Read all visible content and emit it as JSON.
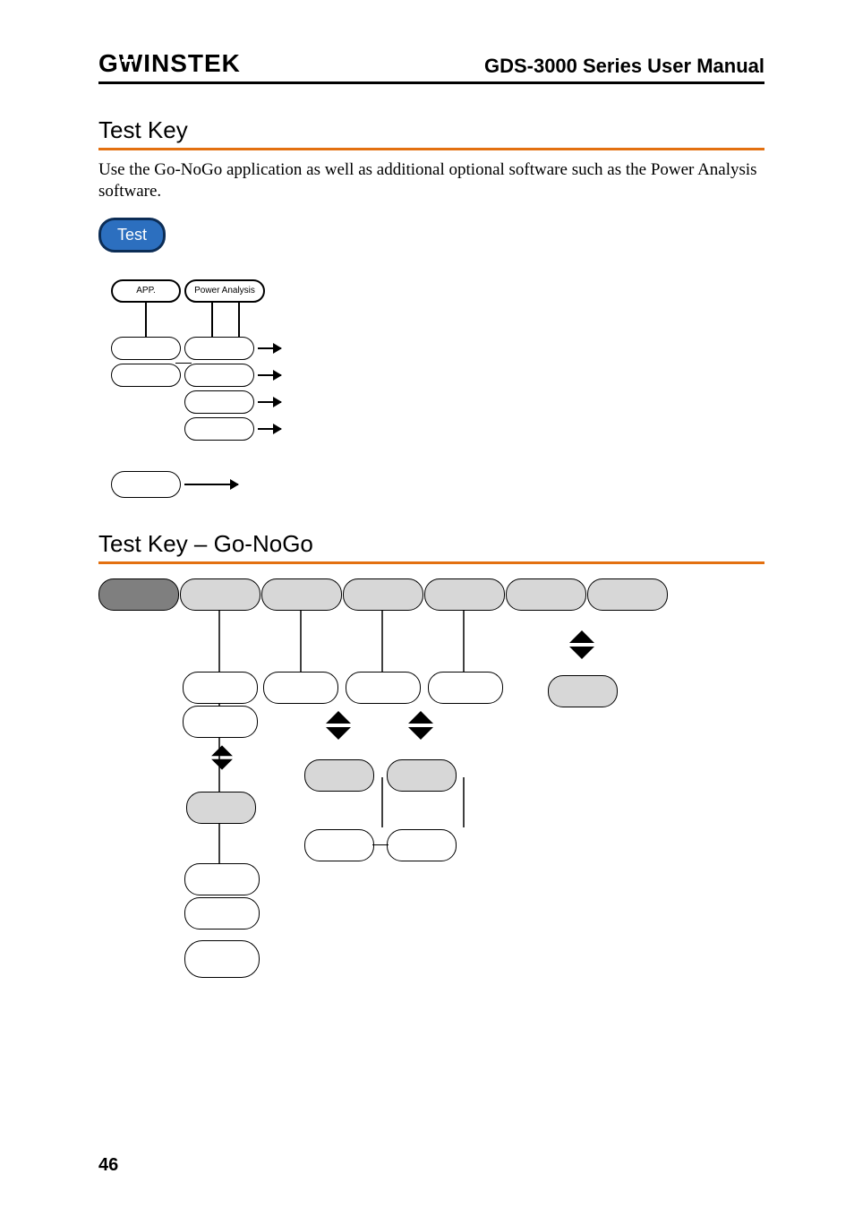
{
  "header": {
    "logo": "GWINSTEK",
    "title": "GDS-3000 Series User Manual"
  },
  "section1": {
    "heading": "Test Key",
    "paragraph": "Use the Go-NoGo application as well as additional optional software such as the Power Analysis software.",
    "test_button": "Test",
    "tabs": {
      "app": "APP.",
      "power": "Power Analysis"
    }
  },
  "section2": {
    "heading": "Test Key – Go-NoGo"
  },
  "page_number": "46"
}
